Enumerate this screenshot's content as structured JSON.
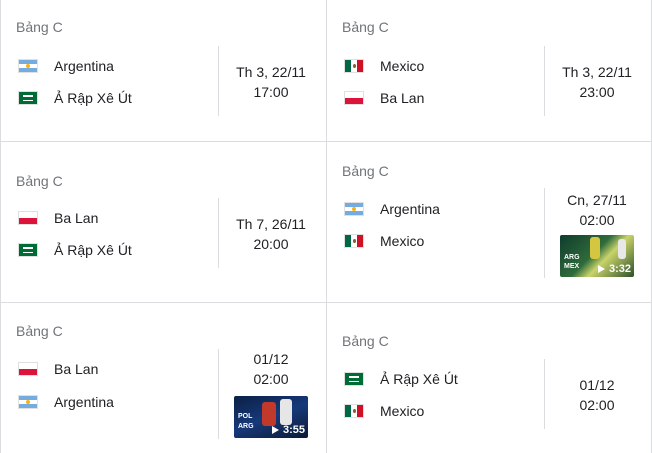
{
  "colors": {
    "border": "#dadce0",
    "text": "#202124",
    "muted": "#70757a"
  },
  "matches": [
    {
      "group": "Bảng C",
      "home": {
        "name": "Argentina",
        "flag": "argentina-flag-icon"
      },
      "away": {
        "name": "Ả Rập Xê Út",
        "flag": "saudi-arabia-flag-icon"
      },
      "date": "Th 3, 22/11",
      "time": "17:00"
    },
    {
      "group": "Bảng C",
      "home": {
        "name": "Mexico",
        "flag": "mexico-flag-icon"
      },
      "away": {
        "name": "Ba Lan",
        "flag": "poland-flag-icon"
      },
      "date": "Th 3, 22/11",
      "time": "23:00"
    },
    {
      "group": "Bảng C",
      "home": {
        "name": "Ba Lan",
        "flag": "poland-flag-icon"
      },
      "away": {
        "name": "Ả Rập Xê Út",
        "flag": "saudi-arabia-flag-icon"
      },
      "date": "Th 7, 26/11",
      "time": "20:00"
    },
    {
      "group": "Bảng C",
      "home": {
        "name": "Argentina",
        "flag": "argentina-flag-icon"
      },
      "away": {
        "name": "Mexico",
        "flag": "mexico-flag-icon"
      },
      "date": "Cn, 27/11",
      "time": "02:00",
      "video": {
        "duration": "3:32",
        "label_top": "ARG",
        "label_bottom": "MEX"
      }
    },
    {
      "group": "Bảng C",
      "home": {
        "name": "Ba Lan",
        "flag": "poland-flag-icon"
      },
      "away": {
        "name": "Argentina",
        "flag": "argentina-flag-icon"
      },
      "date": "01/12",
      "time": "02:00",
      "video": {
        "duration": "3:55",
        "label_top": "POL",
        "label_bottom": "ARG"
      }
    },
    {
      "group": "Bảng C",
      "home": {
        "name": "Ả Rập Xê Út",
        "flag": "saudi-arabia-flag-icon"
      },
      "away": {
        "name": "Mexico",
        "flag": "mexico-flag-icon"
      },
      "date": "01/12",
      "time": "02:00"
    }
  ]
}
